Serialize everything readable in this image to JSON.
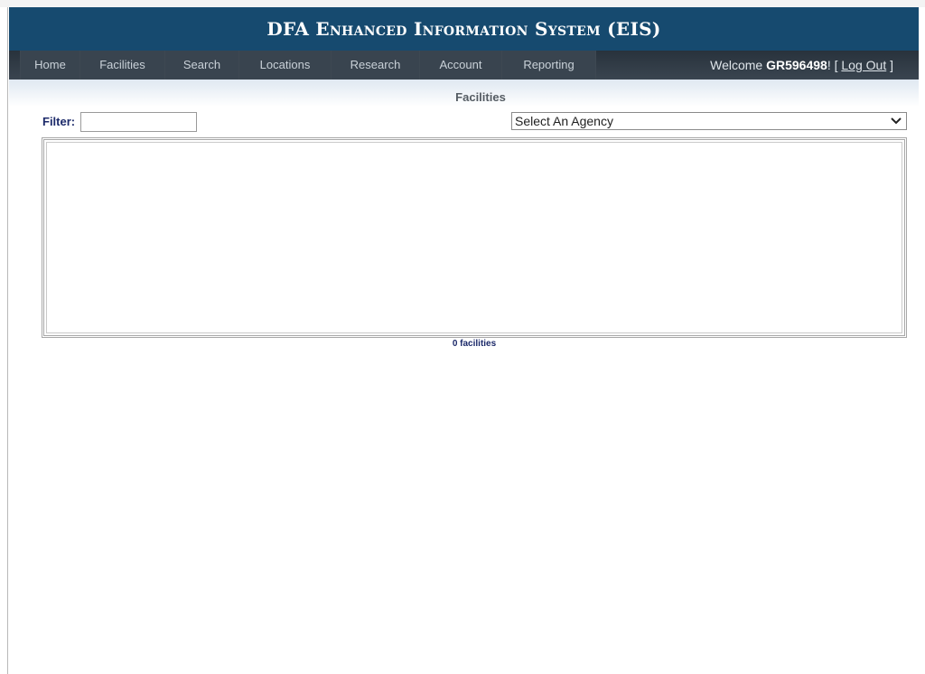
{
  "header": {
    "title": "DFA Enhanced Information System (EIS)"
  },
  "nav": {
    "items": [
      {
        "label": "Home"
      },
      {
        "label": "Facilities"
      },
      {
        "label": "Search"
      },
      {
        "label": "Locations"
      },
      {
        "label": "Research"
      },
      {
        "label": "Account"
      },
      {
        "label": "Reporting"
      }
    ],
    "welcome_prefix": "Welcome ",
    "username": "GR596498",
    "welcome_suffix": "! [ ",
    "logout_label": "Log Out",
    "welcome_end": " ]"
  },
  "page": {
    "title": "Facilities"
  },
  "filter": {
    "label": "Filter:",
    "value": "",
    "placeholder": ""
  },
  "agency_select": {
    "selected": "Select An Agency",
    "icon": "chevron-down-icon"
  },
  "facilities_list": {
    "items": []
  },
  "count_text": "0 facilities",
  "colors": {
    "header_bg": "#164a6f",
    "nav_bg": "#39444f",
    "label_color": "#1c2a6a"
  }
}
